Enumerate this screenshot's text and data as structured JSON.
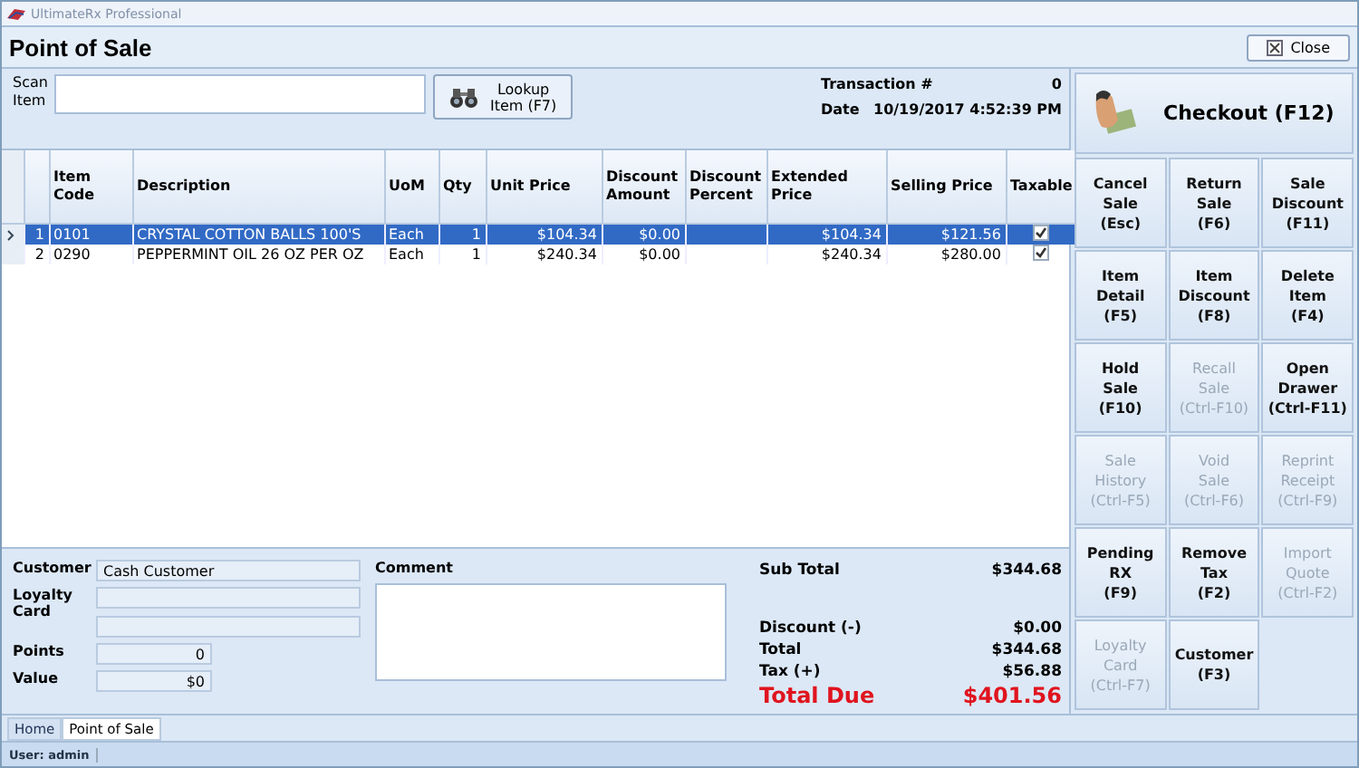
{
  "window": {
    "title": "UltimateRx Professional"
  },
  "header": {
    "title": "Point of Sale",
    "close_button": "Close"
  },
  "scan": {
    "label": "Scan\nItem",
    "lookup_button": "Lookup\nItem (F7)"
  },
  "transaction": {
    "number_label": "Transaction #",
    "number": "0",
    "date_label": "Date",
    "date": "10/19/2017 4:52:39 PM"
  },
  "table": {
    "columns": [
      "",
      "Item\nCode",
      "Description",
      "UoM",
      "Qty",
      "Unit Price",
      "Discount\nAmount",
      "Discount\nPercent",
      "Extended\nPrice",
      "Selling Price",
      "Taxable"
    ],
    "rows": [
      {
        "selected": true,
        "number": "1",
        "item_code": "0101",
        "description": "CRYSTAL COTTON BALLS 100'S",
        "uom": "Each",
        "qty": "1",
        "unit_price": "$104.34",
        "discount_amount": "$0.00",
        "discount_percent": "",
        "extended_price": "$104.34",
        "selling_price": "$121.56",
        "taxable": true
      },
      {
        "selected": false,
        "number": "2",
        "item_code": "0290",
        "description": "PEPPERMINT OIL 26 OZ PER OZ",
        "uom": "Each",
        "qty": "1",
        "unit_price": "$240.34",
        "discount_amount": "$0.00",
        "discount_percent": "",
        "extended_price": "$240.34",
        "selling_price": "$280.00",
        "taxable": true
      }
    ]
  },
  "customer": {
    "customer_label": "Customer",
    "customer_value": "Cash Customer",
    "loyalty_label": "Loyalty\nCard",
    "points_label": "Points",
    "points_value": "0",
    "value_label": "Value",
    "value_value": "$0"
  },
  "comment": {
    "label": "Comment"
  },
  "totals": [
    {
      "kind": "normal",
      "label": "Sub Total",
      "value": "$344.68"
    },
    {
      "kind": "spacer"
    },
    {
      "kind": "normal",
      "label": "Discount (-)",
      "value": "$0.00"
    },
    {
      "kind": "normal",
      "label": "Total",
      "value": "$344.68"
    },
    {
      "kind": "normal",
      "label": "Tax (+)",
      "value": "$56.88"
    },
    {
      "kind": "due",
      "label": "Total Due",
      "value": "$401.56"
    }
  ],
  "checkout_button": "Checkout (F12)",
  "actions": [
    {
      "label": "Cancel\nSale\n(Esc)",
      "disabled": false
    },
    {
      "label": "Return\nSale\n(F6)",
      "disabled": false
    },
    {
      "label": "Sale\nDiscount\n(F11)",
      "disabled": false
    },
    {
      "label": "Item\nDetail\n(F5)",
      "disabled": false
    },
    {
      "label": "Item\nDiscount\n(F8)",
      "disabled": false
    },
    {
      "label": "Delete\nItem\n(F4)",
      "disabled": false
    },
    {
      "label": "Hold\nSale\n(F10)",
      "disabled": false
    },
    {
      "label": "Recall\nSale\n(Ctrl-F10)",
      "disabled": true
    },
    {
      "label": "Open\nDrawer\n(Ctrl-F11)",
      "disabled": false
    },
    {
      "label": "Sale\nHistory\n(Ctrl-F5)",
      "disabled": true
    },
    {
      "label": "Void\nSale\n(Ctrl-F6)",
      "disabled": true
    },
    {
      "label": "Reprint\nReceipt\n(Ctrl-F9)",
      "disabled": true
    },
    {
      "label": "Pending\nRX\n(F9)",
      "disabled": false
    },
    {
      "label": "Remove\nTax\n(F2)",
      "disabled": false
    },
    {
      "label": "Import\nQuote\n(Ctrl-F2)",
      "disabled": true
    },
    {
      "label": "Loyalty\nCard\n(Ctrl-F7)",
      "disabled": true
    },
    {
      "label": "Customer\n(F3)",
      "disabled": false
    }
  ],
  "tabs": [
    {
      "label": "Home",
      "selected": false
    },
    {
      "label": "Point of Sale",
      "selected": true
    }
  ],
  "status_bar": {
    "user": "User: admin"
  }
}
